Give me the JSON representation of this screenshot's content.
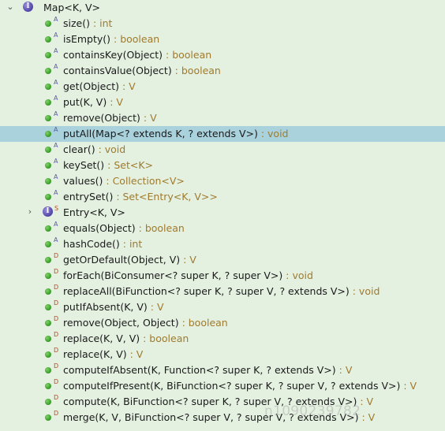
{
  "root": {
    "toggle": "⌄",
    "name": "Map<K, V>",
    "icon_letter": "I"
  },
  "nested": {
    "toggle": "›",
    "icon_letter": "I",
    "modifier": "S"
  },
  "members": [
    {
      "name": "size()",
      "sep": " : ",
      "type": "int",
      "mod": "A"
    },
    {
      "name": "isEmpty()",
      "sep": " : ",
      "type": "boolean",
      "mod": "A"
    },
    {
      "name": "containsKey(Object)",
      "sep": " : ",
      "type": "boolean",
      "mod": "A"
    },
    {
      "name": "containsValue(Object)",
      "sep": " : ",
      "type": "boolean",
      "mod": "A"
    },
    {
      "name": "get(Object)",
      "sep": " : ",
      "type": "V",
      "mod": "A"
    },
    {
      "name": "put(K, V)",
      "sep": " : ",
      "type": "V",
      "mod": "A"
    },
    {
      "name": "remove(Object)",
      "sep": " : ",
      "type": "V",
      "mod": "A"
    },
    {
      "name": "putAll(Map<? extends K, ? extends V>)",
      "sep": " : ",
      "type": "void",
      "mod": "A"
    },
    {
      "name": "clear()",
      "sep": " : ",
      "type": "void",
      "mod": "A"
    },
    {
      "name": "keySet()",
      "sep": " : ",
      "type": "Set<K>",
      "mod": "A"
    },
    {
      "name": "values()",
      "sep": " : ",
      "type": "Collection<V>",
      "mod": "A"
    },
    {
      "name": "entrySet()",
      "sep": " : ",
      "type": "Set<Entry<K, V>>",
      "mod": "A"
    },
    {
      "name": "Entry<K, V>",
      "sep": "",
      "type": "",
      "mod": "S"
    },
    {
      "name": "equals(Object)",
      "sep": " : ",
      "type": "boolean",
      "mod": "A"
    },
    {
      "name": "hashCode()",
      "sep": " : ",
      "type": "int",
      "mod": "A"
    },
    {
      "name": "getOrDefault(Object, V)",
      "sep": " : ",
      "type": "V",
      "mod": "D"
    },
    {
      "name": "forEach(BiConsumer<? super K, ? super V>)",
      "sep": " : ",
      "type": "void",
      "mod": "D"
    },
    {
      "name": "replaceAll(BiFunction<? super K, ? super V, ? extends V>)",
      "sep": " : ",
      "type": "void",
      "mod": "D"
    },
    {
      "name": "putIfAbsent(K, V)",
      "sep": " : ",
      "type": "V",
      "mod": "D"
    },
    {
      "name": "remove(Object, Object)",
      "sep": " : ",
      "type": "boolean",
      "mod": "D"
    },
    {
      "name": "replace(K, V, V)",
      "sep": " : ",
      "type": "boolean",
      "mod": "D"
    },
    {
      "name": "replace(K, V)",
      "sep": " : ",
      "type": "V",
      "mod": "D"
    },
    {
      "name": "computeIfAbsent(K, Function<? super K, ? extends V>)",
      "sep": " : ",
      "type": "V",
      "mod": "D"
    },
    {
      "name": "computeIfPresent(K, BiFunction<? super K, ? super V, ? extends V>)",
      "sep": " : ",
      "type": "V",
      "mod": "D"
    },
    {
      "name": "compute(K, BiFunction<? super K, ? super V, ? extends V>)",
      "sep": " : ",
      "type": "V",
      "mod": "D"
    },
    {
      "name": "merge(K, V, BiFunction<? super V, ? super V, ? extends V>)",
      "sep": " : ",
      "type": "V",
      "mod": "D"
    }
  ],
  "selected_index": 7,
  "watermark": "n1090239782",
  "colors": {
    "background": "#e4f1e1",
    "selection": "#a9d2dd",
    "type_text": "#a07a2c",
    "method_dot": "#3ea02b",
    "interface_icon": "#5a4db0"
  }
}
